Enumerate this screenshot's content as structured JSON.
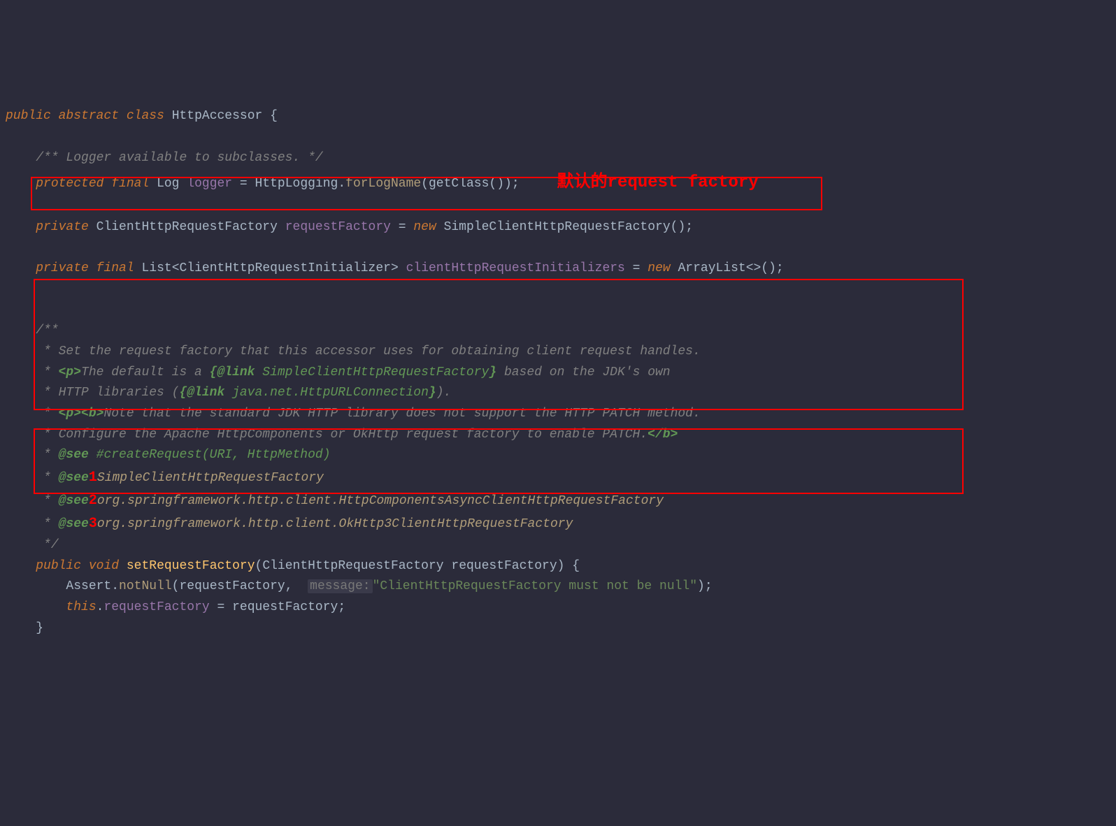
{
  "line1": {
    "public": "public",
    "abstract": "abstract",
    "class": "class",
    "name": "HttpAccessor",
    "brace": "{"
  },
  "line2": {
    "comment": "/** Logger available to subclasses. */"
  },
  "line3": {
    "protected": "protected",
    "final": "final",
    "type": "Log",
    "field": "logger",
    "eq": " = ",
    "cls": "HttpLogging",
    "dot": ".",
    "method": "forLogName",
    "open": "(",
    "getclass": "getClass",
    "close": "());"
  },
  "annotation_red": "默认的request factory",
  "line4": {
    "private": "private",
    "type": "ClientHttpRequestFactory",
    "field": "requestFactory",
    "eq": " = ",
    "new": "new",
    "ctor": "SimpleClientHttpRequestFactory",
    "parens": "();"
  },
  "line5": {
    "private": "private",
    "final": "final",
    "list": "List",
    "lt": "<",
    "generic": "ClientHttpRequestInitializer",
    "gt": ">",
    "field": "clientHttpRequestInitializers",
    "eq": " = ",
    "new": "new",
    "ctor": "ArrayList",
    "diamond": "<>();"
  },
  "javadoc": {
    "open": "/**",
    "l1": " * Set the request factory that this accessor uses for obtaining client request handles.",
    "l2_pre": " * ",
    "l2_p": "<p>",
    "l2_mid": "The default is a ",
    "l2_link_open": "{@link",
    "l2_link_text": " SimpleClientHttpRequestFactory",
    "l2_link_close": "}",
    "l2_post": " based on the JDK's own",
    "l3_pre": " * HTTP libraries (",
    "l3_link_open": "{@link",
    "l3_link_text": " java.net.HttpURLConnection",
    "l3_link_close": "}",
    "l3_post": ").",
    "l4_pre": " * ",
    "l4_p": "<p><b>",
    "l4_text": "Note that the standard JDK HTTP library does not support the HTTP PATCH method.",
    "l5_pre": " * Configure the Apache HttpComponents or OkHttp request factory to enable PATCH.",
    "l5_b": "</b>",
    "see1_pre": " * ",
    "see1_tag": "@see",
    "see1_link": " #createRequest(URI, HttpMethod)",
    "see2_pre": " * ",
    "see2_tag": "@see",
    "see2_num": "1",
    "see2_text": "SimpleClientHttpRequestFactory",
    "see3_pre": " * ",
    "see3_tag": "@see",
    "see3_num": "2",
    "see3_text": "org.springframework.http.client.HttpComponentsAsyncClientHttpRequestFactory",
    "see4_pre": " * ",
    "see4_tag": "@see",
    "see4_num": "3",
    "see4_text": "org.springframework.http.client.OkHttp3ClientHttpRequestFactory",
    "close": " */"
  },
  "method": {
    "public": "public",
    "void": "void",
    "name": "setRequestFactory",
    "open": "(",
    "ptype": "ClientHttpRequestFactory",
    "pname": "requestFactory",
    "close": ") {",
    "assert_cls": "Assert",
    "dot": ".",
    "notnull": "notNull",
    "aopen": "(",
    "arg1": "requestFactory",
    "comma": ", ",
    "hint": "message:",
    "str": "\"ClientHttpRequestFactory must not be null\"",
    "aclose": ");",
    "this": "this",
    "tfield": "requestFactory",
    "eq": " = requestFactory;",
    "brace": "}"
  }
}
